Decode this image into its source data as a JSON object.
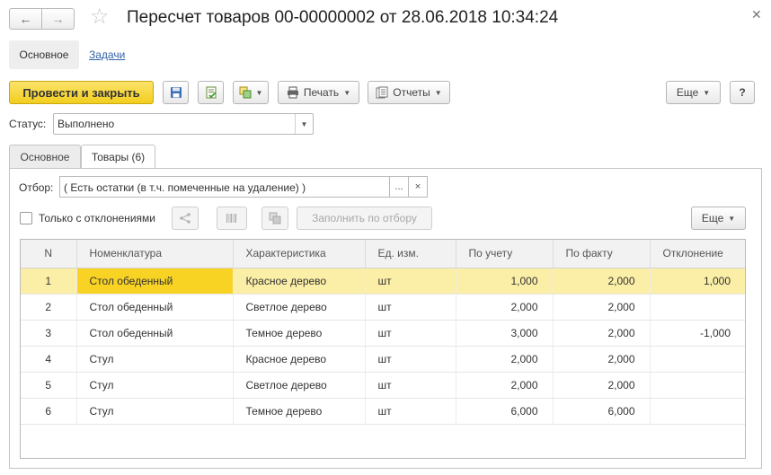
{
  "window": {
    "title": "Пересчет товаров 00-00000002 от 28.06.2018 10:34:24"
  },
  "sections": {
    "main_label": "Основное",
    "tasks_label": "Задачи"
  },
  "toolbar": {
    "post_close_label": "Провести и закрыть",
    "print_label": "Печать",
    "reports_label": "Отчеты",
    "more_label": "Еще",
    "help_label": "?"
  },
  "status": {
    "label": "Статус:",
    "value": "Выполнено"
  },
  "tabs": [
    {
      "label": "Основное",
      "active": false
    },
    {
      "label": "Товары (6)",
      "active": true
    }
  ],
  "filter": {
    "label": "Отбор:",
    "value": "( Есть остатки (в т.ч. помеченные на удаление) )",
    "choose_label": "...",
    "clear_label": "×"
  },
  "goods_toolbar": {
    "only_deviations_label": "Только с отклонениями",
    "only_deviations_checked": false,
    "fill_by_filter_label": "Заполнить по отбору",
    "more_label": "Еще"
  },
  "table": {
    "columns": [
      "N",
      "Номенклатура",
      "Характеристика",
      "Ед. изм.",
      "По учету",
      "По факту",
      "Отклонение"
    ],
    "rows": [
      {
        "n": "1",
        "item": "Стол обеденный",
        "characteristic": "Красное дерево",
        "unit": "шт",
        "accounted": "1,000",
        "actual": "2,000",
        "deviation": "1,000",
        "selected": true
      },
      {
        "n": "2",
        "item": "Стол обеденный",
        "characteristic": "Светлое дерево",
        "unit": "шт",
        "accounted": "2,000",
        "actual": "2,000",
        "deviation": ""
      },
      {
        "n": "3",
        "item": "Стол обеденный",
        "characteristic": "Темное дерево",
        "unit": "шт",
        "accounted": "3,000",
        "actual": "2,000",
        "deviation": "-1,000"
      },
      {
        "n": "4",
        "item": "Стул",
        "characteristic": "Красное дерево",
        "unit": "шт",
        "accounted": "2,000",
        "actual": "2,000",
        "deviation": ""
      },
      {
        "n": "5",
        "item": "Стул",
        "characteristic": "Светлое дерево",
        "unit": "шт",
        "accounted": "2,000",
        "actual": "2,000",
        "deviation": ""
      },
      {
        "n": "6",
        "item": "Стул",
        "characteristic": "Темное дерево",
        "unit": "шт",
        "accounted": "6,000",
        "actual": "6,000",
        "deviation": ""
      }
    ]
  },
  "colors": {
    "primary_button": "#f3ce1f",
    "selected_row": "#fbeea6",
    "selected_cell": "#f8d323",
    "link": "#3363a8"
  }
}
